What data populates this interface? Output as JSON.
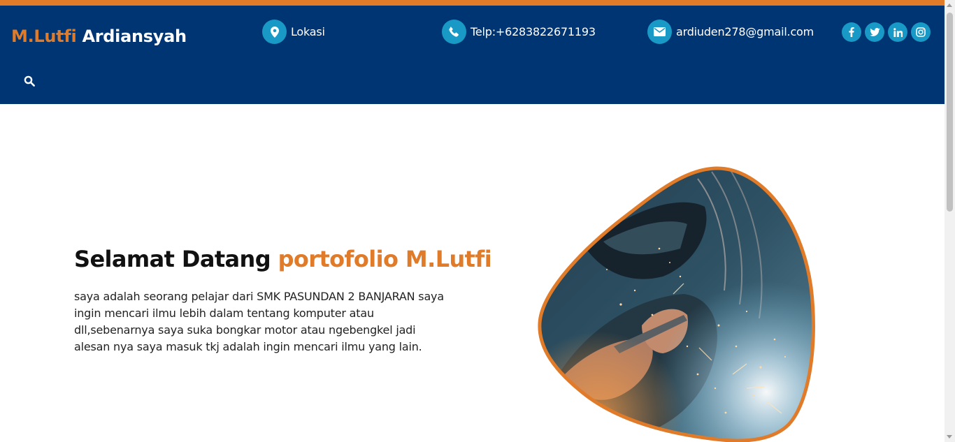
{
  "header": {
    "brand_first": "M.Lutfi",
    "brand_last": "Ardiansyah",
    "location_label": "Lokasi",
    "phone_label": "Telp:+6283822671193",
    "email_label": "ardiuden278@gmail.com"
  },
  "icons": {
    "location": "map-marker-icon",
    "phone": "phone-icon",
    "email": "envelope-icon",
    "search": "search-icon",
    "socials": [
      "facebook-icon",
      "twitter-icon",
      "linkedin-icon",
      "instagram-icon"
    ]
  },
  "hero": {
    "title_plain": "Selamat Datang",
    "title_accent": "portofolio M.Lutfi",
    "description_lines": [
      "saya adalah seorang pelajar dari SMK PASUNDAN 2 BANJARAN saya",
      "ingin mencari ilmu lebih dalam tentang komputer atau",
      "dll,sebenarnya saya suka bongkar motor atau ngebengkel jadi",
      "alesan nya saya masuk tkj adalah ingin mencari ilmu yang lain."
    ]
  },
  "colors": {
    "header_bg": "#003574",
    "accent": "#e07b2a",
    "icon_circle": "#1899c6",
    "text": "#222222"
  }
}
